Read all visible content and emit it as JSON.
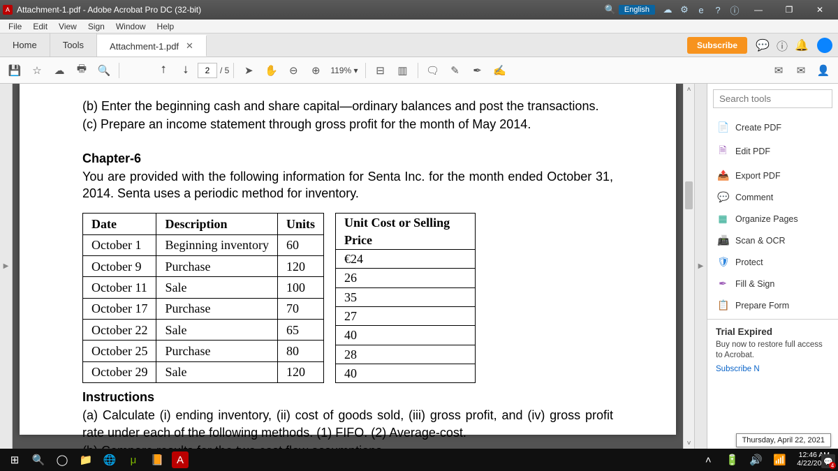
{
  "titlebar": {
    "title": "Attachment-1.pdf - Adobe Acrobat Pro DC (32-bit)",
    "lang": "English"
  },
  "menu": [
    "File",
    "Edit",
    "View",
    "Sign",
    "Window",
    "Help"
  ],
  "tabs": {
    "home": "Home",
    "tools": "Tools",
    "doc": "Attachment-1.pdf",
    "subscribe": "Subscribe"
  },
  "toolbar": {
    "page_cur": "2",
    "page_tot": "/ 5",
    "zoom": "119%"
  },
  "document": {
    "b": "(b) Enter the beginning cash and share capital—ordinary balances and post the transactions.",
    "c": "(c) Prepare an income statement through gross profit for the month of May 2014.",
    "chapter": "Chapter-6",
    "intro": "You are provided with the following information for Senta Inc. for the month ended October 31, 2014. Senta uses a periodic method for inventory.",
    "t1_head": [
      "Date",
      "Description",
      "Units"
    ],
    "t1_rows": [
      [
        "October 1",
        "Beginning inventory",
        "60"
      ],
      [
        "October 9",
        "Purchase",
        "120"
      ],
      [
        "October 11",
        "Sale",
        "100"
      ],
      [
        "October 17",
        "Purchase",
        "70"
      ],
      [
        "October 22",
        "Sale",
        "65"
      ],
      [
        "October 25",
        "Purchase",
        "80"
      ],
      [
        "October 29",
        "Sale",
        "120"
      ]
    ],
    "t2_head": "Unit Cost or Selling Price",
    "t2_rows": [
      "€24",
      "26",
      "35",
      "27",
      "40",
      "28",
      "40"
    ],
    "instr_h": "Instructions",
    "instr_a": "(a) Calculate (i) ending inventory, (ii) cost of goods sold, (iii) gross profit, and (iv) gross profit rate under each of the following methods. (1) FIFO. (2) Average-cost.",
    "instr_b": "(b) Compare results for the two cost flow assumptions."
  },
  "right": {
    "search_ph": "Search tools",
    "tools": [
      "Create PDF",
      "Edit PDF",
      "Export PDF",
      "Comment",
      "Organize Pages",
      "Scan & OCR",
      "Protect",
      "Fill & Sign",
      "Prepare Form"
    ],
    "trial_h": "Trial Expired",
    "trial_tx": "Buy now to restore full access to Acrobat.",
    "trial_link": "Subscribe N"
  },
  "taskbar": {
    "tooltip": "Thursday, April 22, 2021",
    "time": "12:46 AM",
    "date": "4/22/2021",
    "badge": "4"
  }
}
